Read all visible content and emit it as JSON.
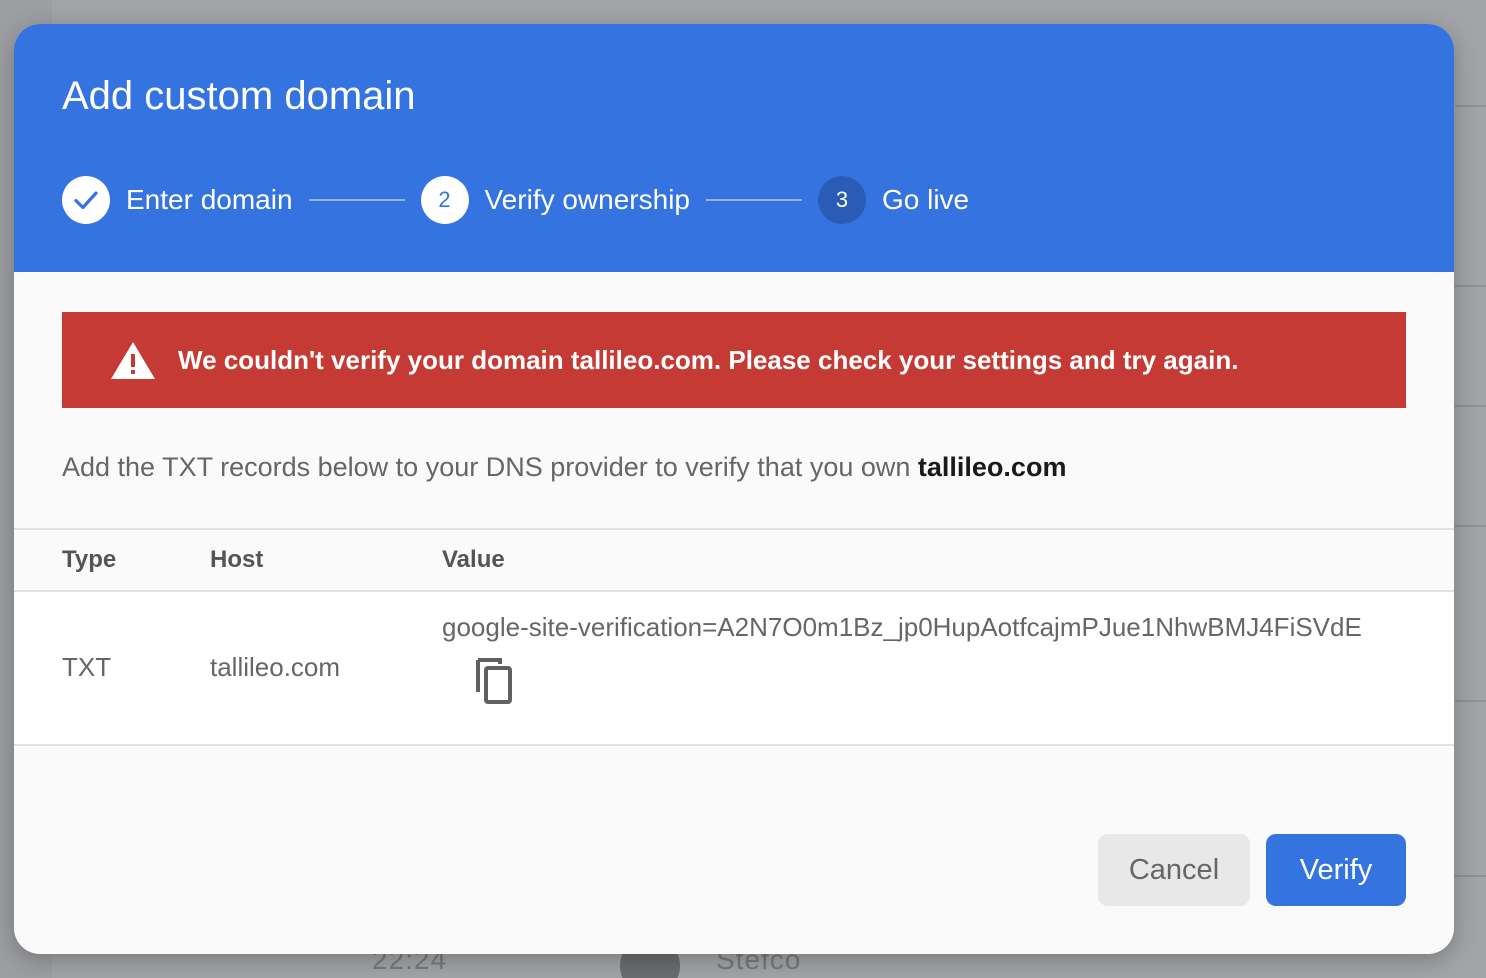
{
  "dialog": {
    "title": "Add custom domain",
    "steps": [
      {
        "number": "",
        "label": "Enter domain",
        "state": "done"
      },
      {
        "number": "2",
        "label": "Verify ownership",
        "state": "active"
      },
      {
        "number": "3",
        "label": "Go live",
        "state": "pending"
      }
    ],
    "alert": {
      "icon": "warning-icon",
      "message": "We couldn't verify your domain tallileo.com. Please check your settings and try again."
    },
    "instructions": {
      "text": "Add the TXT records below to your DNS provider to verify that you own ",
      "domain": "tallileo.com"
    },
    "table": {
      "headers": {
        "type": "Type",
        "host": "Host",
        "value": "Value"
      },
      "rows": [
        {
          "type": "TXT",
          "host": "tallileo.com",
          "value": "google-site-verification=A2N7O0m1Bz_jp0HupAotfcajmPJue1NhwBMJ4FiSVdE",
          "copy_icon": "copy-icon"
        }
      ]
    },
    "buttons": {
      "cancel": "Cancel",
      "verify": "Verify"
    }
  },
  "background": {
    "time_text": "22:24",
    "name_text": "Stefco"
  },
  "colors": {
    "header": "#3574e0",
    "alert": "#c53a34",
    "primary_button": "#3574e0",
    "secondary_button": "#e8e8e8",
    "overlay": "#9c9ea1"
  }
}
